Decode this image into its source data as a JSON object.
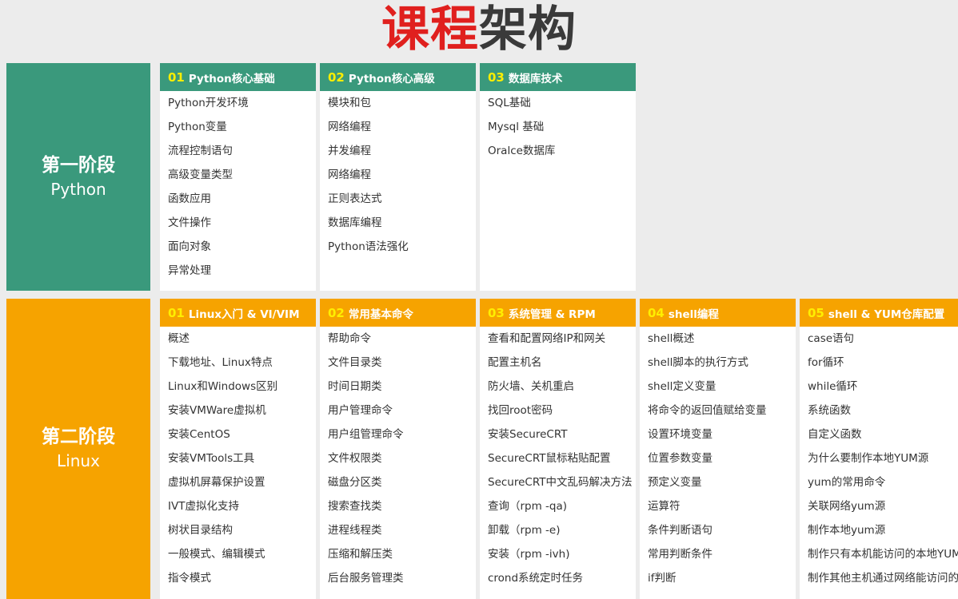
{
  "title": {
    "part1": "课程",
    "part2": "架构"
  },
  "colors": {
    "green": "#3a997c",
    "orange": "#f6a300",
    "title_red": "#e0201e",
    "number_yellow": "#ffee00"
  },
  "stages": [
    {
      "name": "第一阶段",
      "sub": "Python",
      "modules": [
        {
          "num": "01",
          "title": "Python核心基础",
          "items": [
            "Python开发环境",
            "Python变量",
            "流程控制语句",
            "高级变量类型",
            "函数应用",
            "文件操作",
            "面向对象",
            "异常处理"
          ]
        },
        {
          "num": "02",
          "title": "Python核心高级",
          "items": [
            "模块和包",
            "网络编程",
            "并发编程",
            "网络编程",
            "正则表达式",
            "数据库编程",
            "Python语法强化"
          ]
        },
        {
          "num": "03",
          "title": "数据库技术",
          "items": [
            "SQL基础",
            "Mysql 基础",
            "Oralce数据库"
          ]
        }
      ]
    },
    {
      "name": "第二阶段",
      "sub": "Linux",
      "modules": [
        {
          "num": "01",
          "title": "Linux入门 & VI/VIM",
          "items": [
            "概述",
            "下载地址、Linux特点",
            "Linux和Windows区别",
            "安装VMWare虚拟机",
            "安装CentOS",
            "安装VMTools工具",
            "虚拟机屏幕保护设置",
            "IVT虚拟化支持",
            "树状目录结构",
            "一般模式、编辑模式",
            "指令模式"
          ]
        },
        {
          "num": "02",
          "title": "常用基本命令",
          "items": [
            "帮助命令",
            "文件目录类",
            "时间日期类",
            "用户管理命令",
            "用户组管理命令",
            "文件权限类",
            "磁盘分区类",
            "搜索查找类",
            "进程线程类",
            "压缩和解压类",
            "后台服务管理类"
          ]
        },
        {
          "num": "03",
          "title": "系统管理 & RPM",
          "items": [
            "查看和配置网络IP和网关",
            "配置主机名",
            "防火墙、关机重启",
            "找回root密码",
            "安装SecureCRT",
            "SecureCRT鼠标粘贴配置",
            "SecureCRT中文乱码解决方法",
            "查询（rpm -qa)",
            "卸载（rpm -e)",
            "安装（rpm -ivh)",
            "crond系统定时任务"
          ]
        },
        {
          "num": "04",
          "title": "shell编程",
          "items": [
            "shell概述",
            "shell脚本的执行方式",
            "shell定义变量",
            "将命令的返回值赋给变量",
            "设置环境变量",
            "位置参数变量",
            "预定义变量",
            "运算符",
            "条件判断语句",
            "常用判断条件",
            "if判断"
          ]
        },
        {
          "num": "05",
          "title": "shell & YUM仓库配置",
          "items": [
            "case语句",
            "for循环",
            "while循环",
            "系统函数",
            "自定义函数",
            "为什么要制作本地YUM源",
            "yum的常用命令",
            "关联网络yum源",
            "制作本地yum源",
            "制作只有本机能访问的本地YUM源",
            "制作其他主机通过网络能访问的本地YUM源"
          ]
        }
      ]
    }
  ]
}
